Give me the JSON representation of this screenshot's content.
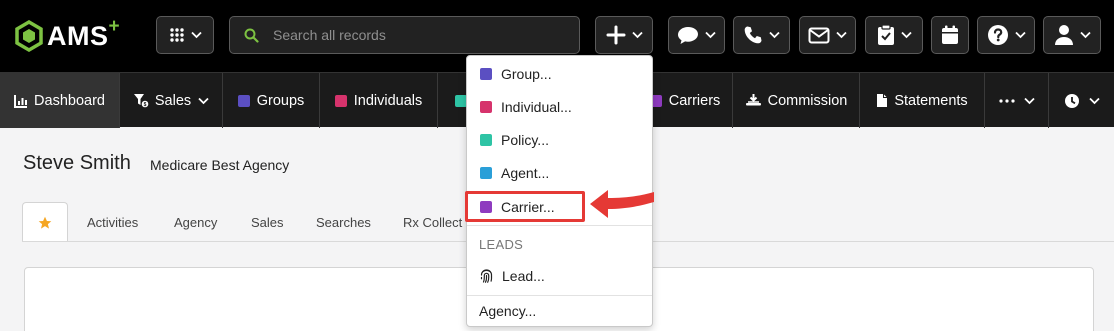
{
  "header": {
    "logo_text": "AMS",
    "logo_plus": "+",
    "apps_icon": "grid-icon",
    "search": {
      "placeholder": "Search all records",
      "value": ""
    },
    "buttons": [
      {
        "name": "create",
        "icon": "plus-icon"
      },
      {
        "name": "messages",
        "icon": "chat-bubble-icon"
      },
      {
        "name": "phone",
        "icon": "phone-icon"
      },
      {
        "name": "email",
        "icon": "envelope-icon"
      },
      {
        "name": "tasks",
        "icon": "clipboard-check-icon"
      },
      {
        "name": "calendar",
        "icon": "calendar-icon"
      },
      {
        "name": "help",
        "icon": "question-circle-icon"
      },
      {
        "name": "user",
        "icon": "user-icon"
      }
    ]
  },
  "nav": {
    "items": [
      {
        "label": "Dashboard",
        "icon": "chart-icon"
      },
      {
        "label": "Sales",
        "icon": "sales-filter-icon"
      },
      {
        "label": "Groups",
        "color": "#5b4fc2"
      },
      {
        "label": "Individuals",
        "color": "#d6336c"
      },
      {
        "label": "Carriers",
        "color": "#8e3bbf"
      },
      {
        "label": "Commission",
        "icon": "commission-icon"
      },
      {
        "label": "Statements",
        "icon": "document-icon"
      },
      {
        "label": "",
        "icon": "more-icon"
      },
      {
        "label": "",
        "icon": "clock-icon"
      }
    ]
  },
  "page": {
    "title": "Steve Smith",
    "subtitle": "Medicare Best Agency",
    "tabs": [
      {
        "label": "",
        "icon": "star-icon",
        "active": true
      },
      {
        "label": "Activities"
      },
      {
        "label": "Agency"
      },
      {
        "label": "Sales"
      },
      {
        "label": "Searches"
      },
      {
        "label": "Rx Collect F"
      }
    ]
  },
  "dropdown": {
    "items": [
      {
        "label": "Group...",
        "color": "#5b4fc2"
      },
      {
        "label": "Individual...",
        "color": "#d6336c"
      },
      {
        "label": "Policy...",
        "color": "#2ec4a5"
      },
      {
        "label": "Agent...",
        "color": "#2a9fd8"
      },
      {
        "label": "Carrier...",
        "color": "#8e3bbf",
        "highlighted": true
      }
    ],
    "leads_header": "LEADS",
    "lead_item": {
      "label": "Lead...",
      "icon": "fingerprint-icon"
    },
    "agency_item": {
      "label": "Agency..."
    }
  },
  "annotation": {
    "color": "#e53935"
  },
  "colors": {
    "logo_green": "#7dc242",
    "nav_teal": "#2ec4a5"
  }
}
